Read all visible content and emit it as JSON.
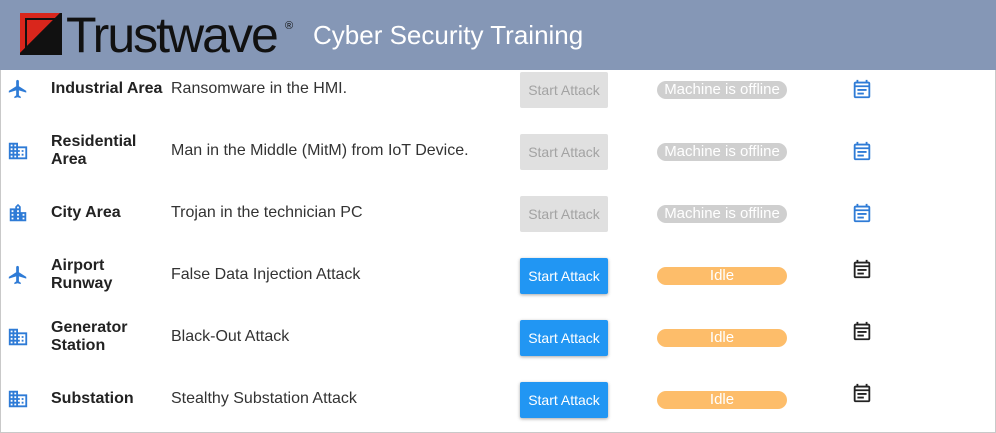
{
  "header": {
    "brand": "Trustwave",
    "registered_mark": "®",
    "title": "Cyber Security Training"
  },
  "colors": {
    "header_bg": "#8597b6",
    "accent_blue": "#2196f3",
    "idle": "#fdbd6a",
    "offline": "#cfcfcf",
    "logo_red": "#d9261c"
  },
  "rows": [
    {
      "icon": "airplane-icon",
      "area": "Industrial Area",
      "description": "Ransomware in the HMI.",
      "button": "Start Attack",
      "button_enabled": false,
      "status": "Machine is offline",
      "calendar_icon": "calendar-icon"
    },
    {
      "icon": "building-icon",
      "area": "Residential Area",
      "description": "Man in the Middle (MitM) from IoT Device.",
      "button": "Start Attack",
      "button_enabled": false,
      "status": "Machine is offline",
      "calendar_icon": "calendar-icon"
    },
    {
      "icon": "city-icon",
      "area": "City Area",
      "description": "Trojan in the technician PC",
      "button": "Start Attack",
      "button_enabled": false,
      "status": "Machine is offline",
      "calendar_icon": "calendar-icon"
    },
    {
      "icon": "airplane-icon",
      "area": "Airport Runway",
      "description": "False Data Injection Attack",
      "button": "Start Attack",
      "button_enabled": true,
      "status": "Idle",
      "calendar_icon": "calendar-icon"
    },
    {
      "icon": "building-icon",
      "area": "Generator Station",
      "description": "Black-Out Attack",
      "button": "Start Attack",
      "button_enabled": true,
      "status": "Idle",
      "calendar_icon": "calendar-icon"
    },
    {
      "icon": "building-icon",
      "area": "Substation",
      "description": "Stealthy Substation Attack",
      "button": "Start Attack",
      "button_enabled": true,
      "status": "Idle",
      "calendar_icon": "calendar-icon"
    }
  ]
}
